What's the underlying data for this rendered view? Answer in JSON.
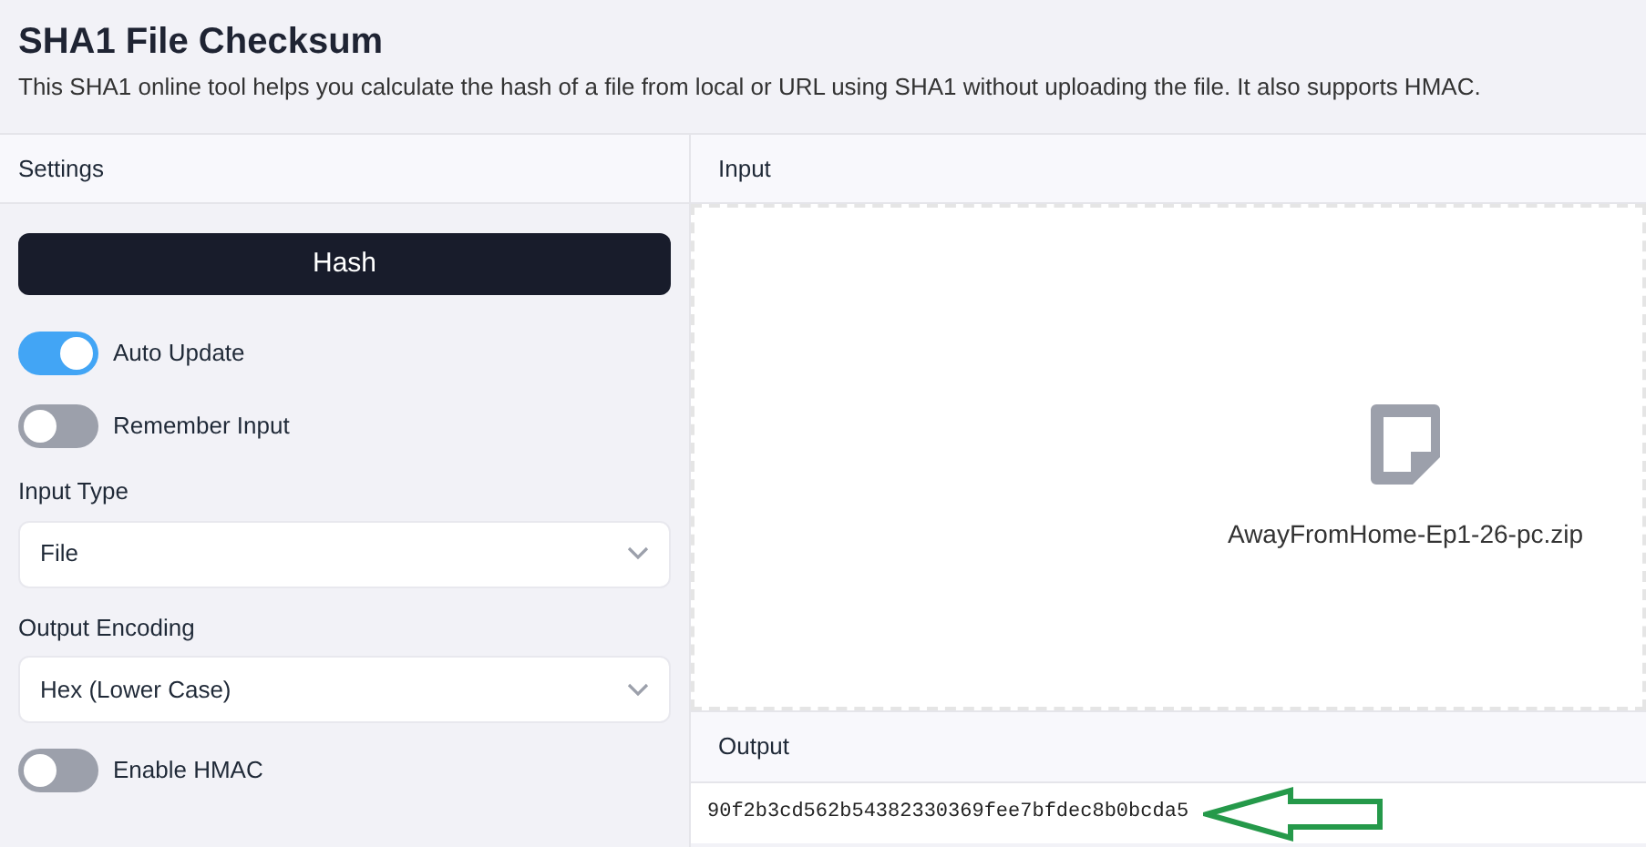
{
  "title": "SHA1 File Checksum",
  "description": "This SHA1 online tool helps you calculate the hash of a file from local or URL using SHA1 without uploading the file. It also supports HMAC.",
  "settings": {
    "heading": "Settings",
    "hash_button": "Hash",
    "controls": [
      {
        "kind": "toggle",
        "label": "Auto Update",
        "on": true
      },
      {
        "kind": "toggle",
        "label": "Remember Input",
        "on": false
      },
      {
        "kind": "select",
        "label": "Input Type",
        "value": "File"
      },
      {
        "kind": "select",
        "label": "Output Encoding",
        "value": "Hex (Lower Case)"
      },
      {
        "kind": "toggle",
        "label": "Enable HMAC",
        "on": false
      }
    ]
  },
  "input": {
    "heading": "Input",
    "file_name": "AwayFromHome-Ep1-26-pc.zip"
  },
  "output": {
    "heading": "Output",
    "value": "90f2b3cd562b54382330369fee7bfdec8b0bcda5"
  }
}
